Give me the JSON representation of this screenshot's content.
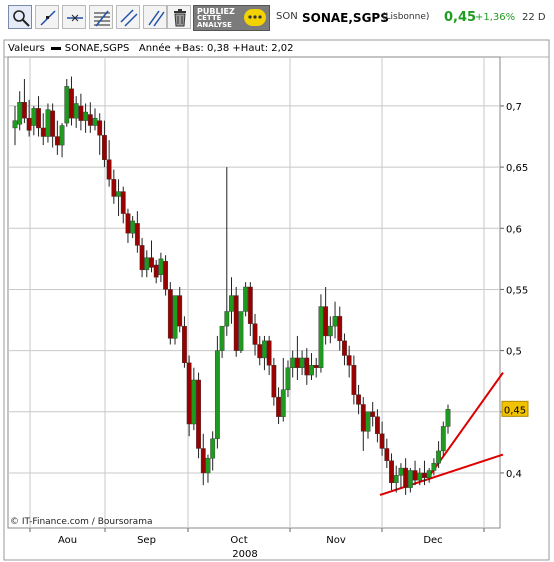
{
  "toolbar": {
    "tools": [
      {
        "name": "zoom-tool",
        "icon": "magnifier-icon"
      },
      {
        "name": "trendline-tool",
        "icon": "diagonal-line-icon"
      },
      {
        "name": "horizontal-line-tool",
        "icon": "horizontal-line-icon"
      },
      {
        "name": "fibonacci-tool",
        "icon": "fibonacci-icon"
      },
      {
        "name": "channel-tool",
        "icon": "channel-icon"
      },
      {
        "name": "parallel-tool",
        "icon": "parallel-lines-icon"
      },
      {
        "name": "delete-tool",
        "icon": "trash-icon"
      }
    ],
    "ad": {
      "line1": "PUBLIEZ",
      "line2": "CETTE",
      "line3": "ANALYSE"
    }
  },
  "quote": {
    "code": "SON",
    "name": "SONAE,SGPS",
    "market": "(Lisbonne)",
    "price": "0,45",
    "change": "+1,36%",
    "time": "22 D"
  },
  "legend": {
    "label": "Valeurs",
    "series": "SONAE,SGPS",
    "stats": "Année +Bas: 0,38 +Haut: 2,02"
  },
  "credit": "© IT-Finance.com / Boursorama",
  "colors": {
    "up": "#1e9b1e",
    "down": "#990000",
    "trend": "#dd0000",
    "price_box": "#f2c200",
    "grid": "#c8c8c8"
  },
  "chart_data": {
    "type": "candlestick",
    "y_ticks": [
      "0,4",
      "0,45",
      "0,5",
      "0,55",
      "0,6",
      "0,65",
      "0,7"
    ],
    "y_tick_values": [
      0.4,
      0.45,
      0.5,
      0.55,
      0.6,
      0.65,
      0.7
    ],
    "ylim": [
      0.355,
      0.74
    ],
    "x_months": [
      "Aou",
      "Sep",
      "Oct",
      "Nov",
      "Dec"
    ],
    "x_year": "2008",
    "last_price_label": "0,45",
    "candles": [
      [
        0.682,
        0.7,
        0.688,
        0.668
      ],
      [
        0.685,
        0.712,
        0.703,
        0.68
      ],
      [
        0.703,
        0.722,
        0.69,
        0.686
      ],
      [
        0.69,
        0.705,
        0.68,
        0.675
      ],
      [
        0.684,
        0.7,
        0.698,
        0.676
      ],
      [
        0.698,
        0.708,
        0.682,
        0.675
      ],
      [
        0.682,
        0.694,
        0.675,
        0.668
      ],
      [
        0.675,
        0.702,
        0.697,
        0.67
      ],
      [
        0.696,
        0.702,
        0.675,
        0.666
      ],
      [
        0.675,
        0.688,
        0.668,
        0.66
      ],
      [
        0.668,
        0.686,
        0.684,
        0.658
      ],
      [
        0.686,
        0.722,
        0.716,
        0.683
      ],
      [
        0.714,
        0.724,
        0.69,
        0.684
      ],
      [
        0.69,
        0.708,
        0.702,
        0.682
      ],
      [
        0.7,
        0.71,
        0.688,
        0.68
      ],
      [
        0.688,
        0.702,
        0.695,
        0.678
      ],
      [
        0.693,
        0.703,
        0.684,
        0.678
      ],
      [
        0.684,
        0.698,
        0.69,
        0.68
      ],
      [
        0.688,
        0.694,
        0.676,
        0.66
      ],
      [
        0.676,
        0.688,
        0.656,
        0.65
      ],
      [
        0.656,
        0.672,
        0.64,
        0.634
      ],
      [
        0.64,
        0.648,
        0.626,
        0.62
      ],
      [
        0.626,
        0.64,
        0.63,
        0.61
      ],
      [
        0.63,
        0.634,
        0.612,
        0.604
      ],
      [
        0.612,
        0.616,
        0.596,
        0.588
      ],
      [
        0.596,
        0.61,
        0.606,
        0.592
      ],
      [
        0.604,
        0.614,
        0.586,
        0.58
      ],
      [
        0.586,
        0.592,
        0.566,
        0.56
      ],
      [
        0.566,
        0.582,
        0.576,
        0.56
      ],
      [
        0.576,
        0.59,
        0.568,
        0.564
      ],
      [
        0.57,
        0.574,
        0.56,
        0.555
      ],
      [
        0.562,
        0.58,
        0.575,
        0.556
      ],
      [
        0.573,
        0.578,
        0.55,
        0.545
      ],
      [
        0.55,
        0.556,
        0.51,
        0.505
      ],
      [
        0.51,
        0.53,
        0.545,
        0.505
      ],
      [
        0.545,
        0.552,
        0.52,
        0.515
      ],
      [
        0.52,
        0.528,
        0.49,
        0.486
      ],
      [
        0.49,
        0.496,
        0.44,
        0.43
      ],
      [
        0.44,
        0.486,
        0.476,
        0.435
      ],
      [
        0.476,
        0.482,
        0.42,
        0.412
      ],
      [
        0.42,
        0.432,
        0.4,
        0.39
      ],
      [
        0.4,
        0.415,
        0.412,
        0.392
      ],
      [
        0.412,
        0.434,
        0.428,
        0.402
      ],
      [
        0.428,
        0.512,
        0.5,
        0.42
      ],
      [
        0.5,
        0.52,
        0.52,
        0.494
      ],
      [
        0.52,
        0.65,
        0.532,
        0.512
      ],
      [
        0.532,
        0.56,
        0.545,
        0.522
      ],
      [
        0.545,
        0.552,
        0.5,
        0.495
      ],
      [
        0.5,
        0.512,
        0.532,
        0.498
      ],
      [
        0.532,
        0.556,
        0.552,
        0.528
      ],
      [
        0.552,
        0.556,
        0.522,
        0.512
      ],
      [
        0.522,
        0.53,
        0.505,
        0.496
      ],
      [
        0.505,
        0.512,
        0.494,
        0.488
      ],
      [
        0.494,
        0.512,
        0.508,
        0.484
      ],
      [
        0.508,
        0.512,
        0.488,
        0.48
      ],
      [
        0.488,
        0.494,
        0.462,
        0.455
      ],
      [
        0.462,
        0.47,
        0.446,
        0.44
      ],
      [
        0.446,
        0.494,
        0.468,
        0.442
      ],
      [
        0.468,
        0.492,
        0.486,
        0.462
      ],
      [
        0.486,
        0.5,
        0.494,
        0.478
      ],
      [
        0.494,
        0.512,
        0.486,
        0.476
      ],
      [
        0.486,
        0.5,
        0.494,
        0.48
      ],
      [
        0.494,
        0.502,
        0.48,
        0.472
      ],
      [
        0.48,
        0.498,
        0.488,
        0.476
      ],
      [
        0.488,
        0.494,
        0.486,
        0.478
      ],
      [
        0.486,
        0.546,
        0.536,
        0.482
      ],
      [
        0.536,
        0.552,
        0.512,
        0.505
      ],
      [
        0.512,
        0.528,
        0.52,
        0.506
      ],
      [
        0.52,
        0.54,
        0.528,
        0.51
      ],
      [
        0.528,
        0.536,
        0.508,
        0.5
      ],
      [
        0.508,
        0.514,
        0.496,
        0.488
      ],
      [
        0.496,
        0.504,
        0.488,
        0.478
      ],
      [
        0.488,
        0.496,
        0.464,
        0.456
      ],
      [
        0.464,
        0.472,
        0.456,
        0.448
      ],
      [
        0.456,
        0.462,
        0.434,
        0.418
      ],
      [
        0.434,
        0.444,
        0.45,
        0.428
      ],
      [
        0.45,
        0.458,
        0.446,
        0.438
      ],
      [
        0.446,
        0.452,
        0.432,
        0.425
      ],
      [
        0.432,
        0.442,
        0.42,
        0.414
      ],
      [
        0.42,
        0.428,
        0.41,
        0.404
      ],
      [
        0.41,
        0.416,
        0.392,
        0.386
      ],
      [
        0.392,
        0.406,
        0.398,
        0.384
      ],
      [
        0.398,
        0.408,
        0.404,
        0.388
      ],
      [
        0.404,
        0.412,
        0.388,
        0.382
      ],
      [
        0.388,
        0.404,
        0.402,
        0.384
      ],
      [
        0.402,
        0.41,
        0.394,
        0.39
      ],
      [
        0.394,
        0.404,
        0.4,
        0.39
      ],
      [
        0.4,
        0.41,
        0.396,
        0.39
      ],
      [
        0.396,
        0.404,
        0.402,
        0.392
      ],
      [
        0.402,
        0.412,
        0.408,
        0.398
      ],
      [
        0.408,
        0.426,
        0.418,
        0.404
      ],
      [
        0.418,
        0.442,
        0.438,
        0.414
      ],
      [
        0.438,
        0.456,
        0.452,
        0.432
      ]
    ],
    "trendlines": [
      {
        "from": [
          0,
          0.382
        ],
        "to": [
          1,
          0.415
        ],
        "frame": "right-edge"
      },
      {
        "from": [
          0,
          0.396
        ],
        "to": [
          1,
          0.482
        ],
        "frame": "right-edge"
      }
    ]
  }
}
